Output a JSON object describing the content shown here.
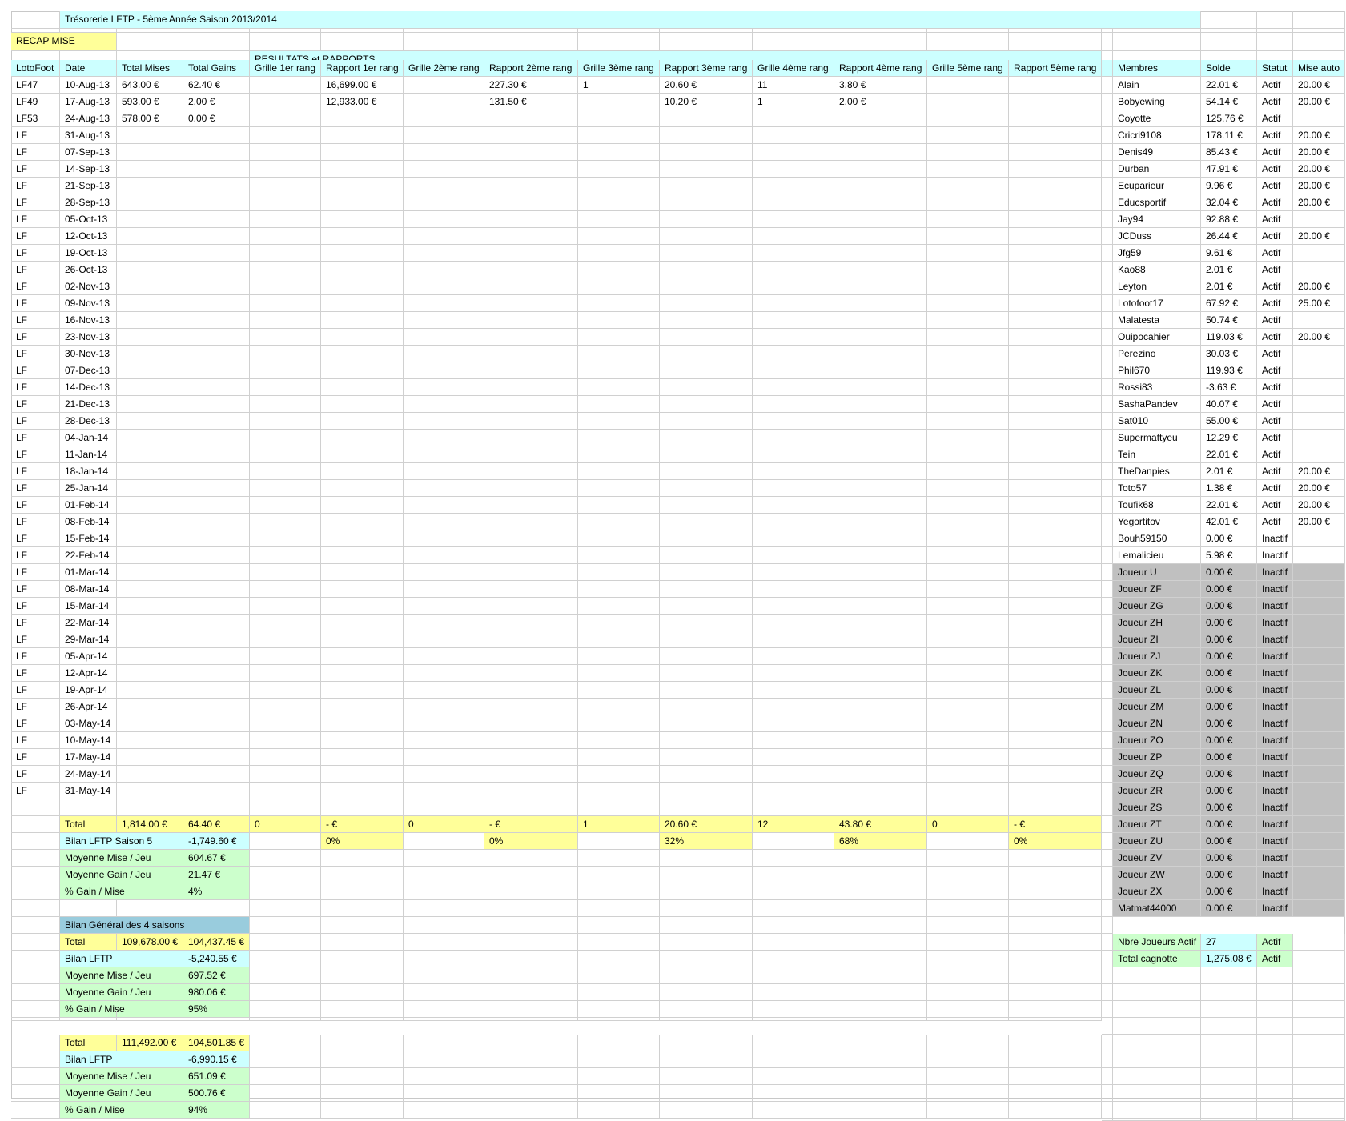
{
  "title": "Trésorerie LFTP - 5ème Année Saison 2013/2014",
  "recap_label": "RECAP MISE",
  "section_label": "RESULTATS et RAPPORTS",
  "headers": [
    "LotoFoot",
    "Date",
    "Total Mises",
    "Total Gains",
    "Grille 1er rang",
    "Rapport 1er rang",
    "Grille 2ème rang",
    "Rapport 2ème rang",
    "Grille 3ème rang",
    "Rapport 3ème rang",
    "Grille 4ème rang",
    "Rapport 4ème rang",
    "Grille 5ème rang",
    "Rapport 5ème rang"
  ],
  "member_headers": [
    "Membres",
    "Solde",
    "Statut",
    "Mise auto"
  ],
  "rows": [
    [
      "LF47",
      "10-Aug-13",
      "643.00 €",
      "62.40 €",
      "",
      "16,699.00 €",
      "",
      "227.30 €",
      "1",
      "20.60 €",
      "11",
      "3.80 €",
      "",
      ""
    ],
    [
      "LF49",
      "17-Aug-13",
      "593.00 €",
      "2.00 €",
      "",
      "12,933.00 €",
      "",
      "131.50 €",
      "",
      "10.20 €",
      "1",
      "2.00 €",
      "",
      ""
    ],
    [
      "LF53",
      "24-Aug-13",
      "578.00 €",
      "0.00 €",
      "",
      "",
      "",
      "",
      "",
      "",
      "",
      "",
      "",
      ""
    ],
    [
      "LF",
      "31-Aug-13"
    ],
    [
      "LF",
      "07-Sep-13"
    ],
    [
      "LF",
      "14-Sep-13"
    ],
    [
      "LF",
      "21-Sep-13"
    ],
    [
      "LF",
      "28-Sep-13"
    ],
    [
      "LF",
      "05-Oct-13"
    ],
    [
      "LF",
      "12-Oct-13"
    ],
    [
      "LF",
      "19-Oct-13"
    ],
    [
      "LF",
      "26-Oct-13"
    ],
    [
      "LF",
      "02-Nov-13"
    ],
    [
      "LF",
      "09-Nov-13"
    ],
    [
      "LF",
      "16-Nov-13"
    ],
    [
      "LF",
      "23-Nov-13"
    ],
    [
      "LF",
      "30-Nov-13"
    ],
    [
      "LF",
      "07-Dec-13"
    ],
    [
      "LF",
      "14-Dec-13"
    ],
    [
      "LF",
      "21-Dec-13"
    ],
    [
      "LF",
      "28-Dec-13"
    ],
    [
      "LF",
      "04-Jan-14"
    ],
    [
      "LF",
      "11-Jan-14"
    ],
    [
      "LF",
      "18-Jan-14"
    ],
    [
      "LF",
      "25-Jan-14"
    ],
    [
      "LF",
      "01-Feb-14"
    ],
    [
      "LF",
      "08-Feb-14"
    ],
    [
      "LF",
      "15-Feb-14"
    ],
    [
      "LF",
      "22-Feb-14"
    ],
    [
      "LF",
      "01-Mar-14"
    ],
    [
      "LF",
      "08-Mar-14"
    ],
    [
      "LF",
      "15-Mar-14"
    ],
    [
      "LF",
      "22-Mar-14"
    ],
    [
      "LF",
      "29-Mar-14"
    ],
    [
      "LF",
      "05-Apr-14"
    ],
    [
      "LF",
      "12-Apr-14"
    ],
    [
      "LF",
      "19-Apr-14"
    ],
    [
      "LF",
      "26-Apr-14"
    ],
    [
      "LF",
      "03-May-14"
    ],
    [
      "LF",
      "10-May-14"
    ],
    [
      "LF",
      "17-May-14"
    ],
    [
      "LF",
      "24-May-14"
    ],
    [
      "LF",
      "31-May-14"
    ]
  ],
  "totals_row": [
    "Total",
    "1,814.00 €",
    "64.40 €",
    "0",
    "- €",
    "0",
    "- €",
    "1",
    "20.60 €",
    "12",
    "43.80 €",
    "0",
    "- €"
  ],
  "bilan_row": [
    "Bilan LFTP Saison 5",
    "-1,749.60 €",
    "0%",
    "0%",
    "32%",
    "68%",
    "0%"
  ],
  "season_stats": [
    [
      "Moyenne Mise / Jeu",
      "604.67 €"
    ],
    [
      "Moyenne Gain / Jeu",
      "21.47 €"
    ],
    [
      "% Gain / Mise",
      "4%"
    ]
  ],
  "general_title": "Bilan Général des 4 saisons",
  "general_blocks": [
    {
      "total": [
        "Total",
        "109,678.00 €",
        "104,437.45 €"
      ],
      "bilan": [
        "Bilan LFTP",
        "-5,240.55 €"
      ],
      "stats": [
        [
          "Moyenne Mise / Jeu",
          "697.52 €"
        ],
        [
          "Moyenne Gain / Jeu",
          "980.06 €"
        ],
        [
          "% Gain / Mise",
          "95%"
        ]
      ]
    },
    {
      "total": [
        "Total",
        "111,492.00 €",
        "104,501.85 €"
      ],
      "bilan": [
        "Bilan LFTP",
        "-6,990.15 €"
      ],
      "stats": [
        [
          "Moyenne Mise / Jeu",
          "651.09 €"
        ],
        [
          "Moyenne Gain / Jeu",
          "500.76 €"
        ],
        [
          "% Gain / Mise",
          "94%"
        ]
      ]
    }
  ],
  "members": [
    [
      "Alain",
      "22.01 €",
      "Actif",
      "20.00 €"
    ],
    [
      "Bobyewing",
      "54.14 €",
      "Actif",
      "20.00 €"
    ],
    [
      "Coyotte",
      "125.76 €",
      "Actif",
      ""
    ],
    [
      "Cricri9108",
      "178.11 €",
      "Actif",
      "20.00 €"
    ],
    [
      "Denis49",
      "85.43 €",
      "Actif",
      "20.00 €"
    ],
    [
      "Durban",
      "47.91 €",
      "Actif",
      "20.00 €"
    ],
    [
      "Ecuparieur",
      "9.96 €",
      "Actif",
      "20.00 €"
    ],
    [
      "Educsportif",
      "32.04 €",
      "Actif",
      "20.00 €"
    ],
    [
      "Jay94",
      "92.88 €",
      "Actif",
      ""
    ],
    [
      "JCDuss",
      "26.44 €",
      "Actif",
      "20.00 €"
    ],
    [
      "Jfg59",
      "9.61 €",
      "Actif",
      ""
    ],
    [
      "Kao88",
      "2.01 €",
      "Actif",
      ""
    ],
    [
      "Leyton",
      "2.01 €",
      "Actif",
      "20.00 €"
    ],
    [
      "Lotofoot17",
      "67.92 €",
      "Actif",
      "25.00 €"
    ],
    [
      "Malatesta",
      "50.74 €",
      "Actif",
      ""
    ],
    [
      "Ouipocahier",
      "119.03 €",
      "Actif",
      "20.00 €"
    ],
    [
      "Perezino",
      "30.03 €",
      "Actif",
      ""
    ],
    [
      "Phil670",
      "119.93 €",
      "Actif",
      ""
    ],
    [
      "Rossi83",
      "-3.63 €",
      "Actif",
      ""
    ],
    [
      "SashaPandev",
      "40.07 €",
      "Actif",
      ""
    ],
    [
      "Sat010",
      "55.00 €",
      "Actif",
      ""
    ],
    [
      "Supermattyeu",
      "12.29 €",
      "Actif",
      ""
    ],
    [
      "Tein",
      "22.01 €",
      "Actif",
      ""
    ],
    [
      "TheDanpies",
      "2.01 €",
      "Actif",
      "20.00 €"
    ],
    [
      "Toto57",
      "1.38 €",
      "Actif",
      "20.00 €"
    ],
    [
      "Toufik68",
      "22.01 €",
      "Actif",
      "20.00 €"
    ],
    [
      "Yegortitov",
      "42.01 €",
      "Actif",
      "20.00 €"
    ],
    [
      "Bouh59150",
      "0.00 €",
      "Inactif",
      ""
    ],
    [
      "Lemalicieu",
      "5.98 €",
      "Inactif",
      ""
    ]
  ],
  "inactive_members": [
    [
      "Joueur U",
      "0.00 €",
      "Inactif"
    ],
    [
      "Joueur ZF",
      "0.00 €",
      "Inactif"
    ],
    [
      "Joueur ZG",
      "0.00 €",
      "Inactif"
    ],
    [
      "Joueur ZH",
      "0.00 €",
      "Inactif"
    ],
    [
      "Joueur ZI",
      "0.00 €",
      "Inactif"
    ],
    [
      "Joueur ZJ",
      "0.00 €",
      "Inactif"
    ],
    [
      "Joueur ZK",
      "0.00 €",
      "Inactif"
    ],
    [
      "Joueur ZL",
      "0.00 €",
      "Inactif"
    ],
    [
      "Joueur ZM",
      "0.00 €",
      "Inactif"
    ],
    [
      "Joueur ZN",
      "0.00 €",
      "Inactif"
    ],
    [
      "Joueur ZO",
      "0.00 €",
      "Inactif"
    ],
    [
      "Joueur ZP",
      "0.00 €",
      "Inactif"
    ],
    [
      "Joueur ZQ",
      "0.00 €",
      "Inactif"
    ],
    [
      "Joueur ZR",
      "0.00 €",
      "Inactif"
    ],
    [
      "Joueur ZS",
      "0.00 €",
      "Inactif"
    ],
    [
      "Joueur ZT",
      "0.00 €",
      "Inactif"
    ],
    [
      "Joueur ZU",
      "0.00 €",
      "Inactif"
    ],
    [
      "Joueur ZV",
      "0.00 €",
      "Inactif"
    ],
    [
      "Joueur ZW",
      "0.00 €",
      "Inactif"
    ],
    [
      "Joueur ZX",
      "0.00 €",
      "Inactif"
    ],
    [
      "Matmat44000",
      "0.00 €",
      "Inactif"
    ]
  ],
  "member_summary": [
    [
      "Nbre Joueurs Actif",
      "27",
      "Actif"
    ],
    [
      "Total cagnotte",
      "1,275.08 €",
      "Actif"
    ]
  ],
  "colors": {
    "cyan": "#ccffff",
    "yellow": "#ffff99",
    "green": "#ccffcc",
    "grey": "#c0c0c0",
    "blue": "#99ccdd",
    "grid": "#d0d0d0"
  }
}
